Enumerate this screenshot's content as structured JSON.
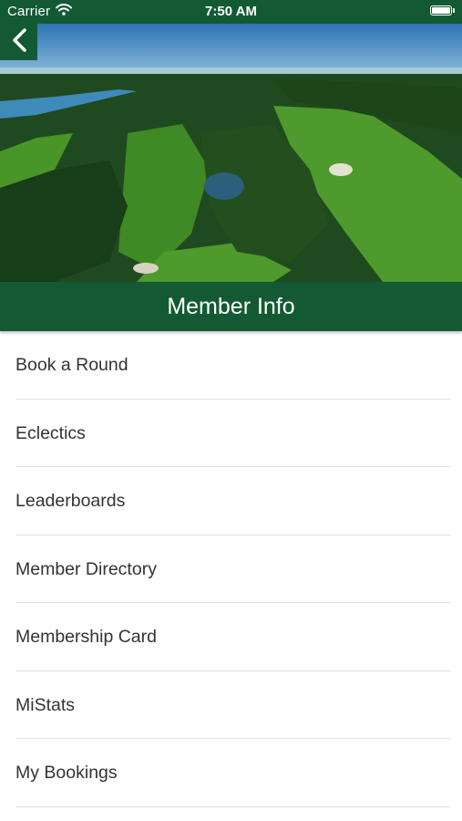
{
  "status_bar": {
    "carrier": "Carrier",
    "time": "7:50 AM"
  },
  "header": {
    "title": "Member Info",
    "back_icon": "chevron-left-icon"
  },
  "menu": {
    "items": [
      {
        "label": "Book a Round"
      },
      {
        "label": "Eclectics"
      },
      {
        "label": "Leaderboards"
      },
      {
        "label": "Member Directory"
      },
      {
        "label": "Membership Card"
      },
      {
        "label": "MiStats"
      },
      {
        "label": "My Bookings"
      }
    ]
  },
  "colors": {
    "brand_green": "#135a34",
    "text": "#333333",
    "divider": "#e2e2e2"
  }
}
